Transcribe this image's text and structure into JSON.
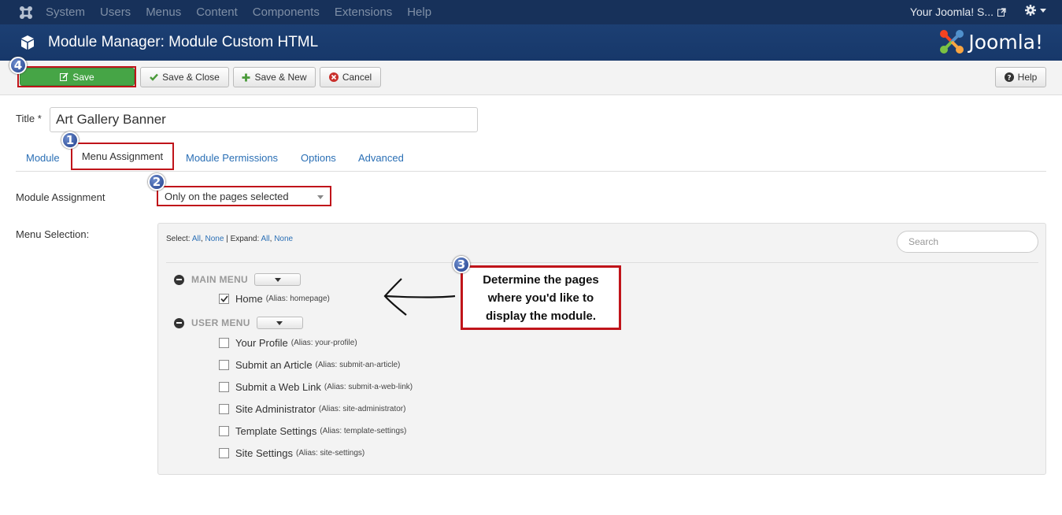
{
  "topnav": {
    "items": [
      "System",
      "Users",
      "Menus",
      "Content",
      "Components",
      "Extensions",
      "Help"
    ],
    "site_link": "Your Joomla! S..."
  },
  "header": {
    "title": "Module Manager: Module Custom HTML",
    "brand": "Joomla!"
  },
  "toolbar": {
    "save": "Save",
    "save_close": "Save & Close",
    "save_new": "Save & New",
    "cancel": "Cancel",
    "help": "Help"
  },
  "form": {
    "title_label": "Title *",
    "title_value": "Art Gallery Banner"
  },
  "tabs": [
    "Module",
    "Menu Assignment",
    "Module Permissions",
    "Options",
    "Advanced"
  ],
  "assignment": {
    "label": "Module Assignment",
    "value": "Only on the pages selected"
  },
  "menu_selection": {
    "label": "Menu Selection:",
    "select_label": "Select:",
    "all": "All",
    "none": "None",
    "expand_label": "Expand:",
    "search_placeholder": "Search",
    "groups": [
      {
        "name": "MAIN MENU",
        "items": [
          {
            "label": "Home",
            "alias": "(Alias: homepage)",
            "checked": true
          }
        ]
      },
      {
        "name": "USER MENU",
        "items": [
          {
            "label": "Your Profile",
            "alias": "(Alias: your-profile)",
            "checked": false
          },
          {
            "label": "Submit an Article",
            "alias": "(Alias: submit-an-article)",
            "checked": false
          },
          {
            "label": "Submit a Web Link",
            "alias": "(Alias: submit-a-web-link)",
            "checked": false
          },
          {
            "label": "Site Administrator",
            "alias": "(Alias: site-administrator)",
            "checked": false
          },
          {
            "label": "Template Settings",
            "alias": "(Alias: template-settings)",
            "checked": false
          },
          {
            "label": "Site Settings",
            "alias": "(Alias: site-settings)",
            "checked": false
          }
        ]
      }
    ]
  },
  "annotations": {
    "badges": [
      "1",
      "2",
      "3",
      "4"
    ],
    "callout_lines": [
      "Determine the pages",
      "where you'd like to",
      "display the module."
    ]
  },
  "colors": {
    "nav_bg": "#17315a",
    "header_bg": "#1c3f73",
    "save_green": "#46a546",
    "highlight_red": "#c0141a",
    "link_blue": "#2a6fb5"
  }
}
